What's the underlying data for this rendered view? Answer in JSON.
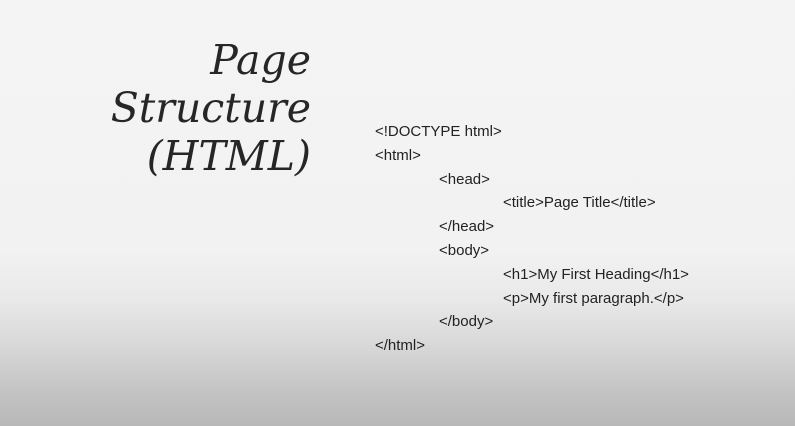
{
  "slide": {
    "title_lines": [
      "Page",
      "Structure",
      "(HTML)"
    ],
    "code_lines": [
      {
        "text": "<!DOCTYPE html>",
        "level": 0
      },
      {
        "text": "<html>",
        "level": 0
      },
      {
        "text": "<head>",
        "level": 1
      },
      {
        "text": "<title>Page Title</title>",
        "level": 2
      },
      {
        "text": "</head>",
        "level": 1
      },
      {
        "text": "<body>",
        "level": 1
      },
      {
        "text": "<h1>My First Heading</h1>",
        "level": 2
      },
      {
        "text": "<p>My first paragraph.</p>",
        "level": 2
      },
      {
        "text": "</body>",
        "level": 1
      },
      {
        "text": "</html>",
        "level": 0
      }
    ]
  }
}
